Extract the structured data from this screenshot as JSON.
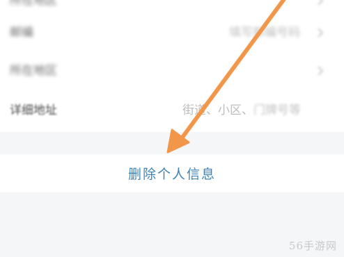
{
  "form": {
    "rows": [
      {
        "label": "所在地区",
        "value": ""
      },
      {
        "label": "邮编",
        "value": "填写邮编号码"
      },
      {
        "label": "所在地区",
        "value": ""
      },
      {
        "label": "详细地址",
        "value_prefix": "街道、小区、",
        "value_suffix": "门牌号等"
      }
    ]
  },
  "delete": {
    "label": "删除个人信息"
  },
  "annotation": {
    "arrow_color": "#f2974a"
  },
  "watermark": {
    "text": "56手游网"
  },
  "icons": {
    "row_chevron": "chevron-right-icon",
    "annotation_arrow": "arrow-pointer-icon"
  }
}
